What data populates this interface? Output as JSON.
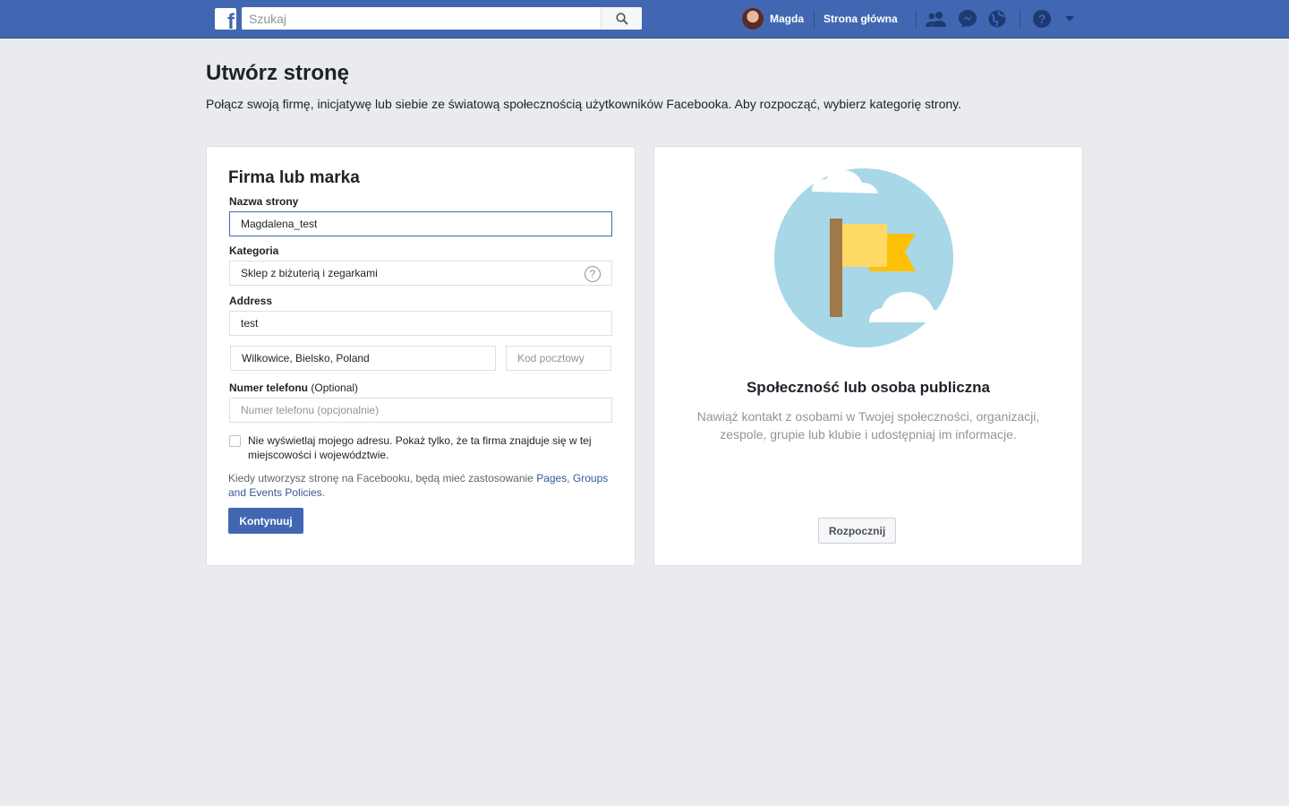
{
  "topbar": {
    "logo_letter": "f",
    "search_placeholder": "Szukaj",
    "user_name": "Magda",
    "home_label": "Strona główna",
    "icons": [
      "friend-requests-icon",
      "messenger-icon",
      "notifications-globe-icon",
      "help-icon",
      "account-menu-chevron-icon"
    ],
    "brand_color": "#4267b2"
  },
  "page": {
    "title": "Utwórz stronę",
    "subtitle": "Połącz swoją firmę, inicjatywę lub siebie ze światową społecznością użytkowników Facebooka. Aby rozpocząć, wybierz kategorię strony."
  },
  "business_card": {
    "title": "Firma lub marka",
    "page_name_label": "Nazwa strony",
    "page_name_value": "Magdalena_test",
    "category_label": "Kategoria",
    "category_value": "Sklep z biżuterią i zegarkami",
    "category_help": "?",
    "address_label": "Address",
    "address_value": "test",
    "city_value": "Wilkowice, Bielsko, Poland",
    "zip_placeholder": "Kod pocztowy",
    "phone_label": "Numer telefonu",
    "phone_optional": "(Optional)",
    "phone_placeholder": "Numer telefonu (opcjonalnie)",
    "hide_address_text": "Nie wyświetlaj mojego adresu. Pokaż tylko, że ta firma znajduje się w tej miejscowości i województwie.",
    "hide_address_checked": false,
    "policy_prefix": "Kiedy utworzysz stronę na Facebooku, będą mieć zastosowanie",
    "policy_link_pages": "Pages",
    "policy_comma": ",",
    "policy_link_groups_events": "Groups and Events Policies",
    "policy_suffix": ".",
    "continue_label": "Kontynuuj"
  },
  "community_card": {
    "title": "Społeczność lub osoba publiczna",
    "description": "Nawiąż kontakt z osobami w Twojej społeczności, organizacji, zespole, grupie lub klubie i udostępniaj im informacje.",
    "start_label": "Rozpocznij"
  }
}
